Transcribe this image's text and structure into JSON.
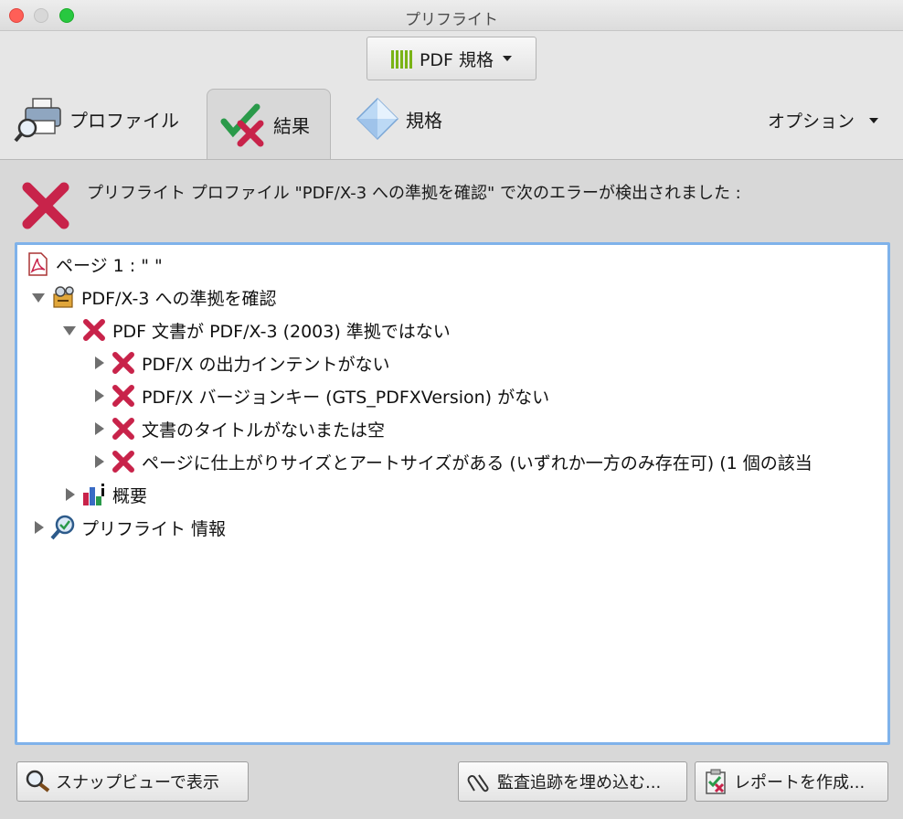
{
  "window": {
    "title": "プリフライト"
  },
  "standard_selector": {
    "label": "PDF 規格",
    "icon": "standards-bars-icon"
  },
  "tabs": [
    {
      "label": "プロファイル",
      "icon": "printer-magnifier-icon"
    },
    {
      "label": "結果",
      "icon": "check-x-icon",
      "active": true
    },
    {
      "label": "規格",
      "icon": "diamond-icon"
    }
  ],
  "options": {
    "label": "オプション"
  },
  "result": {
    "message": "プリフライト プロファイル \"PDF/X-3 への準拠を確認\" で次のエラーが検出されました :"
  },
  "tree": {
    "rows": [
      {
        "label": "ページ 1 : \"                              \"",
        "level": 0,
        "expander": "none",
        "icon": "pdf-file-icon"
      },
      {
        "label": "PDF/X-3 への準拠を確認",
        "level": 0,
        "expander": "expanded",
        "icon": "profile-tools-icon"
      },
      {
        "label": "PDF 文書が PDF/X-3 (2003) 準拠ではない",
        "level": 1,
        "expander": "expanded",
        "icon": "error-x-icon"
      },
      {
        "label": "PDF/X の出力インテントがない",
        "level": 2,
        "expander": "collapsed",
        "icon": "error-x-icon"
      },
      {
        "label": "PDF/X バージョンキー (GTS_PDFXVersion) がない",
        "level": 2,
        "expander": "collapsed",
        "icon": "error-x-icon"
      },
      {
        "label": "文書のタイトルがないまたは空",
        "level": 2,
        "expander": "collapsed",
        "icon": "error-x-icon"
      },
      {
        "label": "ページに仕上がりサイズとアートサイズがある (いずれか一方のみ存在可) (1 個の該当",
        "level": 2,
        "expander": "collapsed",
        "icon": "error-x-icon"
      },
      {
        "label": "概要",
        "level": 1,
        "expander": "collapsed",
        "icon": "summary-chart-icon"
      },
      {
        "label": "プリフライト 情報",
        "level": 0,
        "expander": "collapsed",
        "icon": "info-magnifier-icon"
      }
    ]
  },
  "buttons": {
    "snap": "スナップビューで表示",
    "audit": "監査追跡を埋め込む...",
    "report": "レポートを作成..."
  },
  "colors": {
    "error": "#c8234a",
    "check": "#2a9a4a",
    "accent": "#7fb2ea"
  }
}
